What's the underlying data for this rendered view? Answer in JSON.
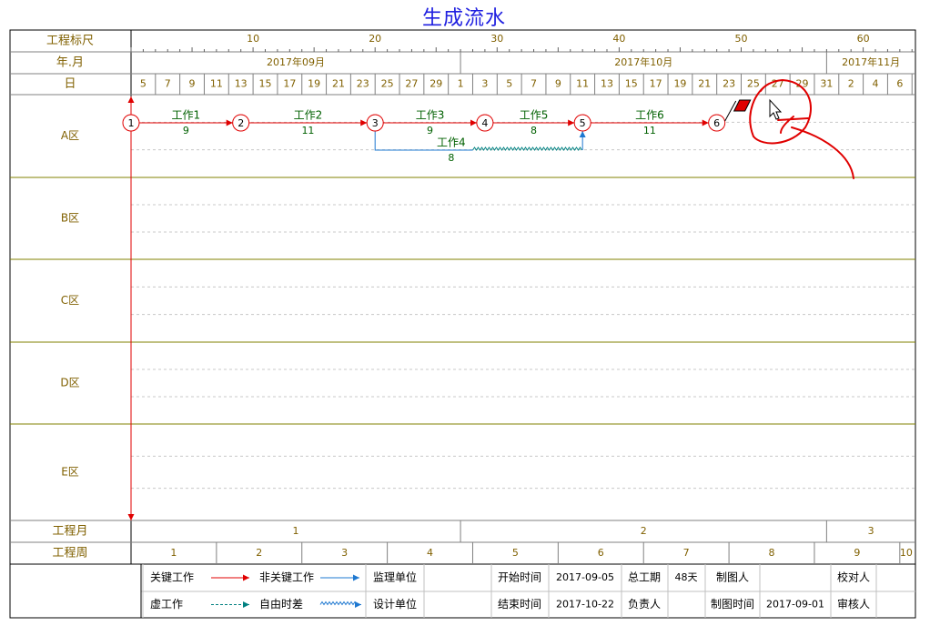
{
  "title": "生成流水",
  "header": {
    "scale_label": "工程标尺",
    "ym_label": "年.月",
    "day_label": "日",
    "scale_ticks": [
      "10",
      "20",
      "30",
      "40",
      "50",
      "60"
    ],
    "months": [
      "2017年09月",
      "2017年10月",
      "2017年11月"
    ],
    "days": [
      "5",
      "7",
      "9",
      "11",
      "13",
      "15",
      "17",
      "19",
      "21",
      "23",
      "25",
      "27",
      "29",
      "1",
      "3",
      "5",
      "7",
      "9",
      "11",
      "13",
      "15",
      "17",
      "19",
      "21",
      "23",
      "25",
      "27",
      "29",
      "31",
      "2",
      "4",
      "6"
    ]
  },
  "zones": [
    "A区",
    "B区",
    "C区",
    "D区",
    "E区"
  ],
  "network": {
    "nodes": [
      "1",
      "2",
      "3",
      "4",
      "5",
      "6"
    ],
    "tasks": [
      {
        "name": "工作1",
        "duration": "9"
      },
      {
        "name": "工作2",
        "duration": "11"
      },
      {
        "name": "工作3",
        "duration": "9"
      },
      {
        "name": "工作5",
        "duration": "8"
      },
      {
        "name": "工作6",
        "duration": "11"
      },
      {
        "name": "工作4",
        "duration": "8"
      }
    ]
  },
  "footer": {
    "month_label": "工程月",
    "week_label": "工程周",
    "months": [
      "1",
      "2",
      "3"
    ],
    "weeks": [
      "1",
      "2",
      "3",
      "4",
      "5",
      "6",
      "7",
      "8",
      "9",
      "10"
    ]
  },
  "legend": {
    "critical": "关键工作",
    "noncritical": "非关键工作",
    "dummy": "虚工作",
    "float": "自由时差",
    "supervisor": "监理单位",
    "designer": "设计单位",
    "start_label": "开始时间",
    "start_value": "2017-09-05",
    "end_label": "结束时间",
    "end_value": "2017-10-22",
    "duration_label": "总工期",
    "duration_value": "48天",
    "owner_label": "负责人",
    "drafter_label": "制图人",
    "draft_time_label": "制图时间",
    "draft_time_value": "2017-09-01",
    "checker_label": "校对人",
    "reviewer_label": "审核人"
  },
  "colors": {
    "critical": "#e00000",
    "noncritical": "#1e78d0",
    "dummy": "#008080",
    "label_text": "#806000",
    "task_text": "#006000",
    "grid_line": "#808000",
    "title": "#2020e0",
    "annotation": "#e00000"
  },
  "icons": [
    "flag-icon",
    "mouse-cursor-icon"
  ]
}
